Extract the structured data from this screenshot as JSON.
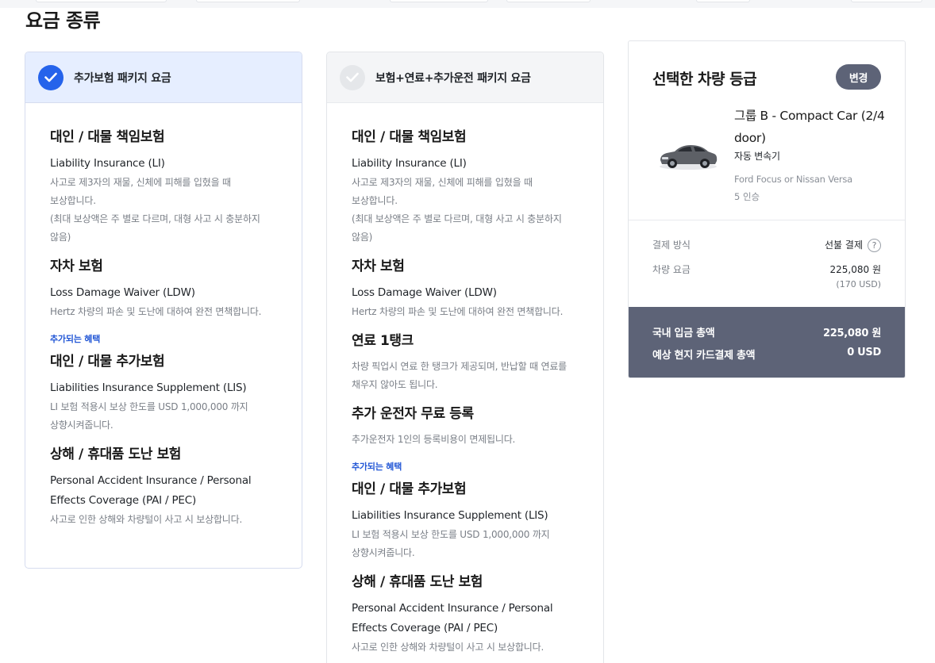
{
  "section_title": "요금 종류",
  "plans": [
    {
      "name": "추가보험 패키지 요금",
      "selected": true,
      "items": [
        {
          "title": "대인 / 대물 책임보험",
          "en": "Liability Insurance (LI)",
          "desc": [
            "사고로 제3자의 재물, 신체에 피해를 입혔을 때",
            "보상합니다.",
            "(최대 보상액은 주 별로 다르며, 대형 사고 시 충분하지",
            "않음)"
          ]
        },
        {
          "title": "자차 보험",
          "en": "Loss Damage Waiver (LDW)",
          "desc": [
            "Hertz 차량의 파손 및 도난에 대하여 완전 면책합니다."
          ]
        }
      ],
      "benefit_label": "추가되는 혜택",
      "benefits": [
        {
          "title": "대인 / 대물 추가보험",
          "en": "Liabilities Insurance Supplement (LIS)",
          "desc": [
            "LI 보험 적용시 보상 한도를 USD 1,000,000 까지",
            "상향시켜줍니다."
          ]
        },
        {
          "title": "상해 / 휴대품 도난 보험",
          "en_lines": [
            "Personal Accident Insurance / Personal",
            "Effects Coverage (PAI / PEC)"
          ],
          "desc": [
            "사고로 인한 상해와 차량털이 사고 시 보상합니다."
          ]
        }
      ]
    },
    {
      "name": "보험+연료+추가운전 패키지 요금",
      "selected": false,
      "items": [
        {
          "title": "대인 / 대물 책임보험",
          "en": "Liability Insurance (LI)",
          "desc": [
            "사고로 제3자의 재물, 신체에 피해를 입혔을 때",
            "보상합니다.",
            "(최대 보상액은 주 별로 다르며, 대형 사고 시 충분하지",
            "않음)"
          ]
        },
        {
          "title": "자차 보험",
          "en": "Loss Damage Waiver (LDW)",
          "desc": [
            "Hertz 차량의 파손 및 도난에 대하여 완전 면책합니다."
          ]
        },
        {
          "title": "연료 1탱크",
          "desc": [
            "차량 픽업시 연료 한 탱크가 제공되며, 반납할 때 연료를",
            "채우지 않아도 됩니다."
          ]
        },
        {
          "title": "추가 운전자 무료 등록",
          "desc": [
            "추가운전자 1인의 등록비용이 면제됩니다."
          ]
        }
      ],
      "benefit_label": "추가되는 혜택",
      "benefits": [
        {
          "title": "대인 / 대물 추가보험",
          "en": "Liabilities Insurance Supplement (LIS)",
          "desc": [
            "LI 보험 적용시 보상 한도를 USD 1,000,000 까지",
            "상향시켜줍니다."
          ]
        },
        {
          "title": "상해 / 휴대품 도난 보험",
          "en_lines": [
            "Personal Accident Insurance / Personal",
            "Effects Coverage (PAI / PEC)"
          ],
          "desc": [
            "사고로 인한 상해와 차량털이 사고 시 보상합니다."
          ]
        }
      ]
    }
  ],
  "summary": {
    "title": "선택한 차량 등급",
    "change_label": "변경",
    "car_class_lines": [
      "그룹 B - Compact Car (2/4",
      "door)"
    ],
    "transmission": "자동 변속기",
    "model": "Ford Focus or Nissan Versa",
    "seats": "5 인승",
    "payment_method_label": "결제 방식",
    "payment_method_value": "선불 결제",
    "help_icon": "?",
    "price_label": "차량 요금",
    "price_value": "225,080 원",
    "price_usd": "(170 USD)",
    "domestic_total_label": "국내 입금 총액",
    "domestic_total_value": "225,080 원",
    "local_total_label": "예상 현지 카드결제 총액",
    "local_total_value": "0 USD"
  },
  "colors": {
    "accent": "#2563eb",
    "selected_header_bg": "#e6eeff",
    "summary_dark": "#5d6377",
    "benefit_link": "#2458d6"
  }
}
